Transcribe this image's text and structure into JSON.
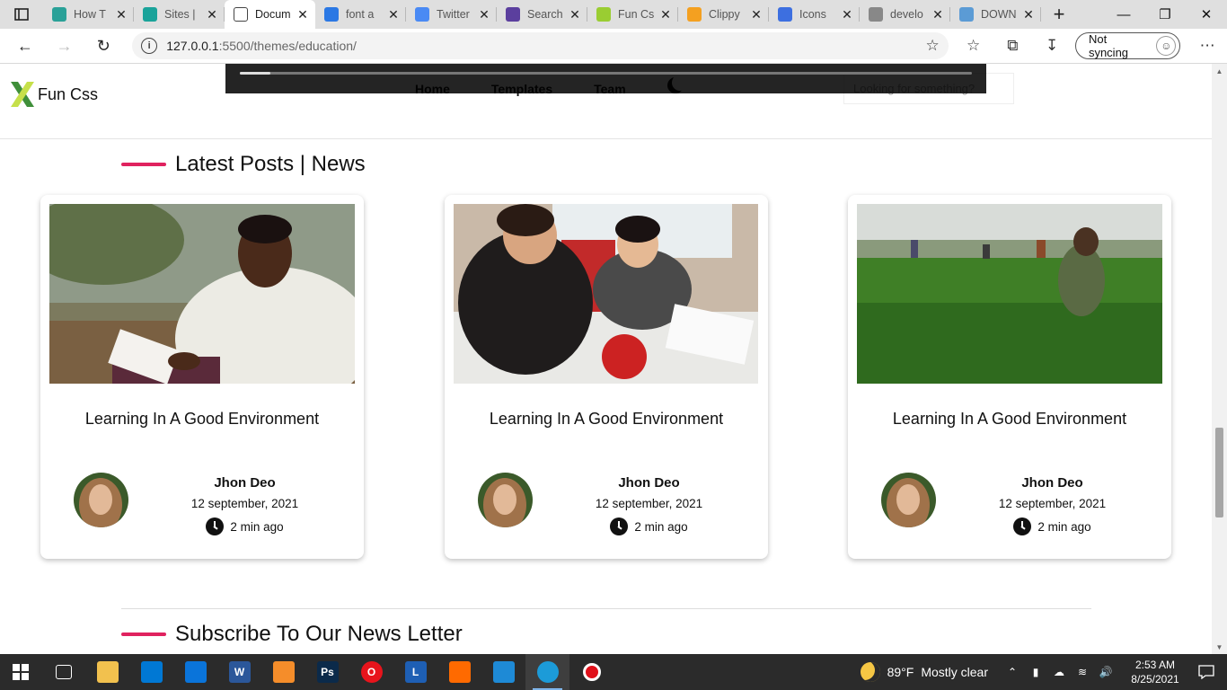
{
  "browser": {
    "tabs": [
      {
        "title": "How T",
        "favicon_color": "#2aa198",
        "active": false
      },
      {
        "title": "Sites |",
        "favicon_color": "#1aa39a",
        "active": false
      },
      {
        "title": "Docum",
        "favicon_color": "#ffffff",
        "active": true
      },
      {
        "title": "font a",
        "favicon_color": "#2b78e4",
        "active": false
      },
      {
        "title": "Twitter",
        "favicon_color": "#4a8af4",
        "active": false
      },
      {
        "title": "Search",
        "favicon_color": "#5b3f9e",
        "active": false
      },
      {
        "title": "Fun Cs",
        "favicon_color": "#9acd32",
        "active": false
      },
      {
        "title": "Clippy",
        "favicon_color": "#f4a020",
        "active": false
      },
      {
        "title": "Icons",
        "favicon_color": "#3d6fe0",
        "active": false
      },
      {
        "title": "develo",
        "favicon_color": "#888888",
        "active": false
      },
      {
        "title": "DOWN",
        "favicon_color": "#5b9bd5",
        "active": false
      }
    ],
    "url_host": "127.0.0.1",
    "url_rest": ":5500/themes/education/",
    "sync_label": "Not syncing"
  },
  "site": {
    "logo_text": "Fun Css",
    "nav": [
      "Home",
      "Templates",
      "Team"
    ],
    "search_placeholder": "Looking for something?",
    "accent": "#e0225f"
  },
  "sections": {
    "latest_title": "Latest Posts | News",
    "subscribe_title": "Subscribe To Our News Letter"
  },
  "posts": [
    {
      "title": "Learning In A Good Environment",
      "author": "Jhon Deo",
      "date": "12 september, 2021",
      "read_time": "2 min ago"
    },
    {
      "title": "Learning In A Good Environment",
      "author": "Jhon Deo",
      "date": "12 september, 2021",
      "read_time": "2 min ago"
    },
    {
      "title": "Learning In A Good Environment",
      "author": "Jhon Deo",
      "date": "12 september, 2021",
      "read_time": "2 min ago"
    }
  ],
  "taskbar": {
    "apps": [
      {
        "name": "task-view-icon",
        "color": "#2b2b2b",
        "label": ""
      },
      {
        "name": "file-explorer-icon",
        "color": "#f2c14e",
        "label": ""
      },
      {
        "name": "store-icon",
        "color": "#0078d4",
        "label": ""
      },
      {
        "name": "mail-icon",
        "color": "#0a74da",
        "label": ""
      },
      {
        "name": "word-icon",
        "color": "#2b579a",
        "label": "W"
      },
      {
        "name": "uc-browser-icon",
        "color": "#f58d2a",
        "label": ""
      },
      {
        "name": "photoshop-icon",
        "color": "#0b2a4a",
        "label": "Ps"
      },
      {
        "name": "opera-icon",
        "color": "#e8141c",
        "label": "O"
      },
      {
        "name": "lens-icon",
        "color": "#1e5fb4",
        "label": "L"
      },
      {
        "name": "avast-icon",
        "color": "#ff6a00",
        "label": ""
      },
      {
        "name": "vscode-icon",
        "color": "#1e8ad6",
        "label": ""
      },
      {
        "name": "edge-icon",
        "color": "#1c9bd8",
        "label": ""
      },
      {
        "name": "recorder-icon",
        "color": "#111111",
        "label": ""
      }
    ],
    "weather_temp": "89°F",
    "weather_text": "Mostly clear",
    "time": "2:53 AM",
    "date": "8/25/2021"
  }
}
